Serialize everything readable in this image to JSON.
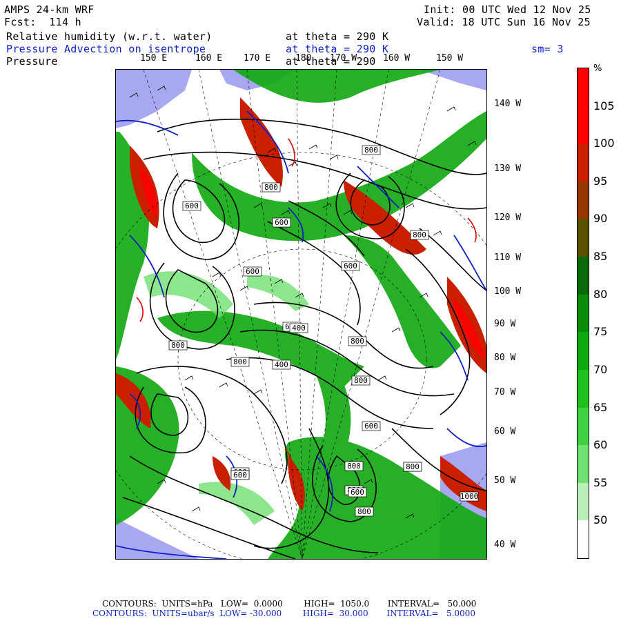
{
  "header": {
    "model": "AMPS 24-km WRF",
    "fcst": "Fcst:  114 h",
    "init": "Init: 00 UTC Wed 12 Nov 25",
    "valid": "Valid: 18 UTC Sun 16 Nov 25",
    "field1": "Relative humidity (w.r.t. water)",
    "field1_level": "at theta = 290 K",
    "field2": "Pressure Advection on isentrope",
    "field2_level": "at theta = 290 K",
    "smoothing": "sm= 3",
    "field3": "Pressure",
    "field3_level": "at theta = 290"
  },
  "longitude_labels": [
    "150 E",
    "160 E",
    "170 E",
    "180",
    "170 W",
    "160 W",
    "150 W"
  ],
  "latitude_labels": [
    "140 W",
    "130 W",
    "120 W",
    "110 W",
    "100 W",
    "90 W",
    "80 W",
    "70 W",
    "60 W",
    "50 W",
    "40 W"
  ],
  "colorbar": {
    "unit": "%",
    "labels": [
      "105",
      "100",
      "95",
      "90",
      "85",
      "80",
      "75",
      "70",
      "65",
      "60",
      "55",
      "50"
    ],
    "colors": [
      "#ff0000",
      "#c82000",
      "#963600",
      "#5a5000",
      "#0a6a0a",
      "#0a8c0a",
      "#10a810",
      "#20c020",
      "#40d040",
      "#70e070",
      "#b8f0b8",
      "#ffffff"
    ]
  },
  "contour_labels": [
    "800",
    "800",
    "600",
    "600",
    "600",
    "600",
    "800",
    "800",
    "800",
    "800",
    "600",
    "400",
    "400",
    "800",
    "600",
    "600",
    "800",
    "800",
    "800",
    "800",
    "600",
    "800",
    "1000",
    "800",
    "600"
  ],
  "footer": {
    "line1": "CONTOURS:  UNITS=hPa   LOW=  0.0000        HIGH=  1050.0       INTERVAL=   50.000",
    "line2": "CONTOURS:  UNITS=ubar/s  LOW= -30.000        HIGH=  30.000       INTERVAL=   5.0000"
  },
  "colors": {
    "land": "#a8a8f0",
    "contour": "#000000",
    "advection": "#0b1fc4",
    "advection_pos": "#e00000"
  }
}
